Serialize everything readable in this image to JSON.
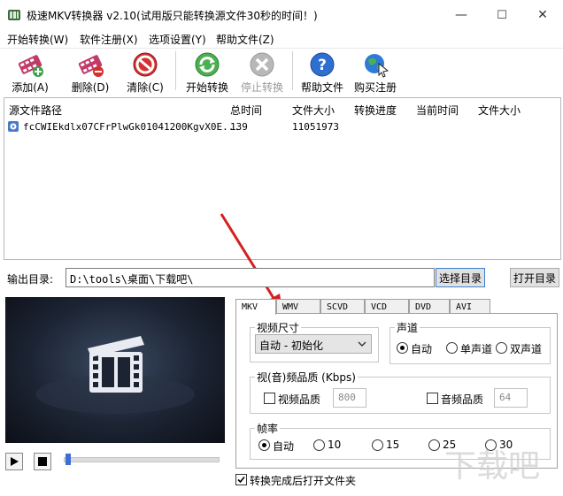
{
  "window": {
    "title": "极速MKV转换器 v2.10(试用版只能转换源文件30秒的时间！)",
    "minimize": "—",
    "maximize": "☐",
    "close": "✕"
  },
  "menu": [
    "开始转换(W)",
    "软件注册(X)",
    "选项设置(Y)",
    "帮助文件(Z)"
  ],
  "toolbar": {
    "add": "添加(A)",
    "delete": "删除(D)",
    "clear": "清除(C)",
    "start": "开始转换",
    "stop": "停止转换",
    "help": "帮助文件",
    "buy": "购买注册"
  },
  "file_table": {
    "columns": [
      "源文件路径",
      "总时间",
      "文件大小",
      "转换进度",
      "当前时间",
      "文件大小"
    ],
    "rows": [
      {
        "path": "fcCWIEkdlx07CFrPlwGk01041200KgvX0E...",
        "total_time": "139",
        "size": "11051973",
        "progress": "",
        "current_time": "",
        "out_size": ""
      }
    ]
  },
  "output": {
    "label": "输出目录:",
    "path": "D:\\tools\\桌面\\下载吧\\",
    "choose_button": "选择目录",
    "open_button": "打开目录"
  },
  "tabs": [
    "MKV",
    "WMV",
    "SCVD",
    "VCD",
    "DVD",
    "AVI"
  ],
  "active_tab": "MKV",
  "video_size": {
    "title": "视频尺寸",
    "selected": "自动 - 初始化"
  },
  "channels": {
    "title": "声道",
    "options": [
      "自动",
      "单声道",
      "双声道"
    ],
    "selected": "自动"
  },
  "quality": {
    "title": "视(音)频品质 (Kbps)",
    "video_label": "视频品质",
    "video_value": "800",
    "audio_label": "音频品质",
    "audio_value": "64"
  },
  "framerate": {
    "title": "帧率",
    "options": [
      "自动",
      "10",
      "15",
      "25",
      "30"
    ],
    "selected": "自动"
  },
  "open_folder_after": {
    "label": "转换完成后打开文件夹",
    "checked": true
  },
  "watermark": "下载吧",
  "colors": {
    "accent_arrow": "#d42020",
    "preview_bg": "#1c2433",
    "seek_thumb": "#3a6fd8"
  }
}
